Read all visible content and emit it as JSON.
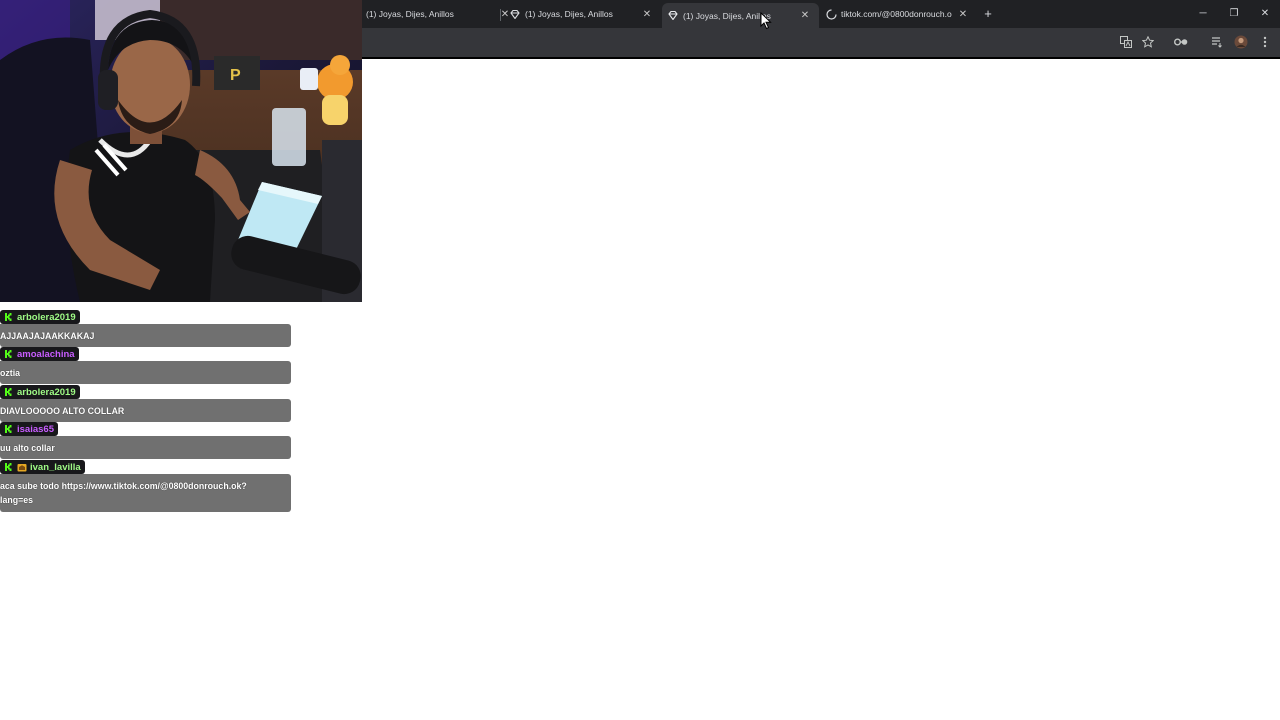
{
  "browser": {
    "tabs": [
      {
        "title": "(1) Joyas, Dijes, Anillos",
        "favicon": "none",
        "active": false
      },
      {
        "title": "(1) Joyas, Dijes, Anillos",
        "favicon": "jewel-icon",
        "active": false
      },
      {
        "title": "(1) Joyas, Dijes, Anillos",
        "favicon": "jewel-icon",
        "active": true
      },
      {
        "title": "tiktok.com/@0800donrouch.o",
        "favicon": "loading-spinner-icon",
        "active": false
      }
    ],
    "new_tab_glyph": "+",
    "close_glyph": "✕",
    "window_controls": {
      "minimize": "─",
      "maximize": "❐",
      "close": "✕"
    },
    "toolbar_icons": [
      "translate-icon",
      "star-icon",
      "extensions-icon",
      "reading-list-icon",
      "profile-avatar",
      "menu-icon"
    ]
  },
  "chat": {
    "messages": [
      {
        "username": "arbolera2019",
        "name_color": "#9ffb86",
        "sub_badge": false,
        "text": "AJJAAJAJAAKKAKAJ"
      },
      {
        "username": "amoalachina",
        "name_color": "#c85dff",
        "sub_badge": false,
        "text": "oztia"
      },
      {
        "username": "arbolera2019",
        "name_color": "#9ffb86",
        "sub_badge": false,
        "text": "DIAVLOOOOO ALTO COLLAR"
      },
      {
        "username": "isaias65",
        "name_color": "#c85dff",
        "sub_badge": false,
        "text": "uu alto collar"
      },
      {
        "username": "ivan_lavilla",
        "name_color": "#9ffb86",
        "sub_badge": true,
        "text": "aca sube todo https://www.tiktok.com/@0800donrouch.ok?lang=es"
      }
    ],
    "badge_color": "#53fc18"
  },
  "colors": {
    "tabstrip": "#202124",
    "toolbar": "#35363a",
    "chat_bubble": "#707070"
  }
}
